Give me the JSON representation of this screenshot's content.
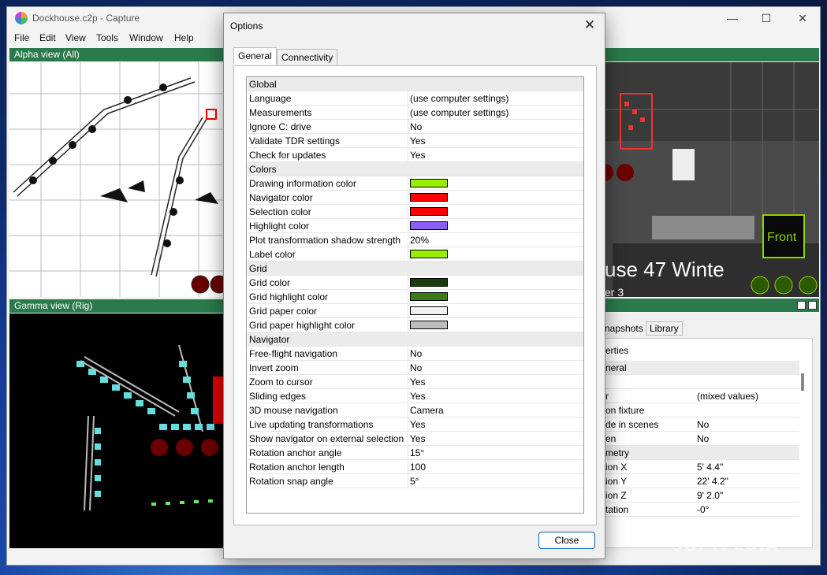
{
  "app": {
    "title": "Dockhouse.c2p - Capture",
    "menu": [
      "File",
      "Edit",
      "View",
      "Tools",
      "Window",
      "Help"
    ],
    "alpha_view": "Alpha view  (All)",
    "gamma_view": "Gamma view  (Rig)",
    "render_text": "use 47 Winte",
    "render_subtext": "er 3",
    "front_label": "Front",
    "props_tabs": [
      "napshots",
      "Library"
    ],
    "props_title": "erties",
    "props_rows": [
      {
        "k": "neral",
        "v": "",
        "section": true
      },
      {
        "k": "",
        "v": ""
      },
      {
        "k": "r",
        "v": "(mixed values)"
      },
      {
        "k": "on fixture",
        "v": ""
      },
      {
        "k": "de in scenes",
        "v": "No"
      },
      {
        "k": "en",
        "v": "No"
      },
      {
        "k": "metry",
        "v": "",
        "section": true
      },
      {
        "k": "ion X",
        "v": "5' 4.4\""
      },
      {
        "k": "ion Y",
        "v": "22' 4.2\""
      },
      {
        "k": "ion Z",
        "v": "9' 2.0\""
      },
      {
        "k": "tation",
        "v": "-0°"
      }
    ]
  },
  "dialog": {
    "title": "Options",
    "tabs": [
      "General",
      "Connectivity"
    ],
    "close_label": "Close",
    "rows": [
      {
        "k": "Global",
        "section": true
      },
      {
        "k": "Language",
        "v": "(use computer settings)"
      },
      {
        "k": "Measurements",
        "v": "(use computer settings)"
      },
      {
        "k": "Ignore C: drive",
        "v": "No"
      },
      {
        "k": "Validate TDR settings",
        "v": "Yes"
      },
      {
        "k": "Check for updates",
        "v": "Yes"
      },
      {
        "k": "Colors",
        "section": true
      },
      {
        "k": "Drawing information color",
        "color": "#99ee00"
      },
      {
        "k": "Navigator color",
        "color": "#ff0000"
      },
      {
        "k": "Selection color",
        "color": "#ff0000"
      },
      {
        "k": "Highlight color",
        "color": "#8b5cf6"
      },
      {
        "k": "Plot transformation shadow strength",
        "v": "20%"
      },
      {
        "k": "Label color",
        "color": "#99ee00"
      },
      {
        "k": "Grid",
        "section": true
      },
      {
        "k": "Grid color",
        "color": "#1a3a0a"
      },
      {
        "k": "Grid highlight color",
        "color": "#3d7a10"
      },
      {
        "k": "Grid paper color",
        "color": "#f2f2f2"
      },
      {
        "k": "Grid paper highlight color",
        "color": "#bcbcbc"
      },
      {
        "k": "Navigator",
        "section": true
      },
      {
        "k": "Free-flight navigation",
        "v": "No"
      },
      {
        "k": "Invert zoom",
        "v": "No"
      },
      {
        "k": "Zoom to cursor",
        "v": "Yes"
      },
      {
        "k": "Sliding edges",
        "v": "Yes"
      },
      {
        "k": "3D mouse navigation",
        "v": "Camera"
      },
      {
        "k": "Live updating transformations",
        "v": "Yes"
      },
      {
        "k": "Show navigator on external selection",
        "v": "Yes"
      },
      {
        "k": "Rotation anchor angle",
        "v": "15°"
      },
      {
        "k": "Rotation anchor length",
        "v": "100"
      },
      {
        "k": "Rotation snap angle",
        "v": "5°"
      }
    ]
  },
  "watermark": "SOFTPEDIA"
}
